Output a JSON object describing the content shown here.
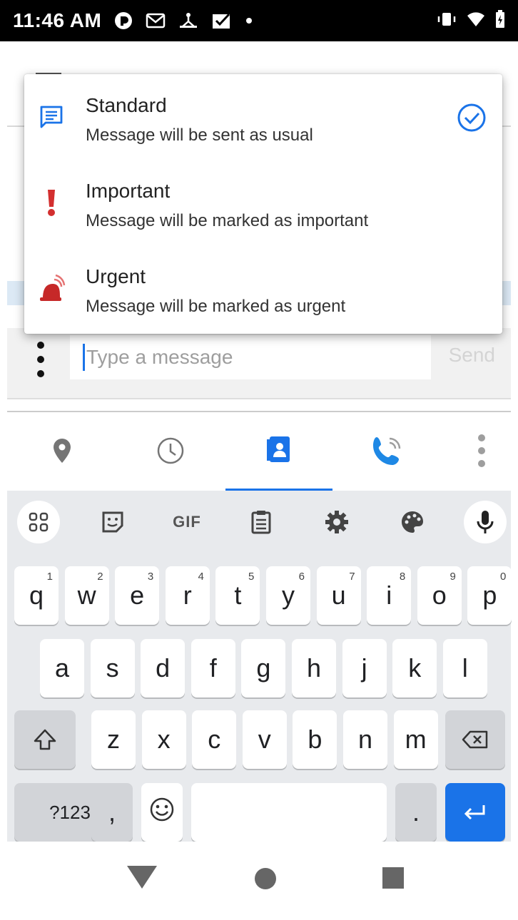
{
  "status_bar": {
    "time": "11:46 AM",
    "icons": [
      "pocket-cast-icon",
      "gmail-icon",
      "network-icon",
      "inbox-icon",
      "dot-icon",
      "vibrate-icon",
      "wifi-icon",
      "battery-icon"
    ]
  },
  "compose": {
    "placeholder": "Type a message",
    "send_label": "Send"
  },
  "tabs": [
    {
      "icon": "location-pin-icon"
    },
    {
      "icon": "clock-icon"
    },
    {
      "icon": "contact-card-icon",
      "active": true
    },
    {
      "icon": "phone-call-icon"
    },
    {
      "icon": "more-vert-icon"
    }
  ],
  "priority_menu": {
    "options": [
      {
        "title": "Standard",
        "subtitle": "Message will be sent as usual",
        "icon": "message-icon",
        "selected": true
      },
      {
        "title": "Important",
        "subtitle": "Message will be marked as important",
        "icon": "exclamation-icon",
        "selected": false
      },
      {
        "title": "Urgent",
        "subtitle": "Message will be marked as urgent",
        "icon": "alarm-icon",
        "selected": false
      }
    ]
  },
  "keyboard": {
    "toolbar": [
      "apps-grid-icon",
      "sticker-icon",
      "GIF",
      "clipboard-icon",
      "settings-icon",
      "palette-icon",
      "mic-icon"
    ],
    "gif_label": "GIF",
    "row1": [
      {
        "k": "q",
        "h": "1"
      },
      {
        "k": "w",
        "h": "2"
      },
      {
        "k": "e",
        "h": "3"
      },
      {
        "k": "r",
        "h": "4"
      },
      {
        "k": "t",
        "h": "5"
      },
      {
        "k": "y",
        "h": "6"
      },
      {
        "k": "u",
        "h": "7"
      },
      {
        "k": "i",
        "h": "8"
      },
      {
        "k": "o",
        "h": "9"
      },
      {
        "k": "p",
        "h": "0"
      }
    ],
    "row2": [
      "a",
      "s",
      "d",
      "f",
      "g",
      "h",
      "j",
      "k",
      "l"
    ],
    "row3": [
      "z",
      "x",
      "c",
      "v",
      "b",
      "n",
      "m"
    ],
    "symbols_label": "?123",
    "comma_label": ",",
    "period_label": "."
  },
  "colors": {
    "accent": "#1a73e8",
    "important": "#d32f2f",
    "urgent": "#c62828"
  }
}
